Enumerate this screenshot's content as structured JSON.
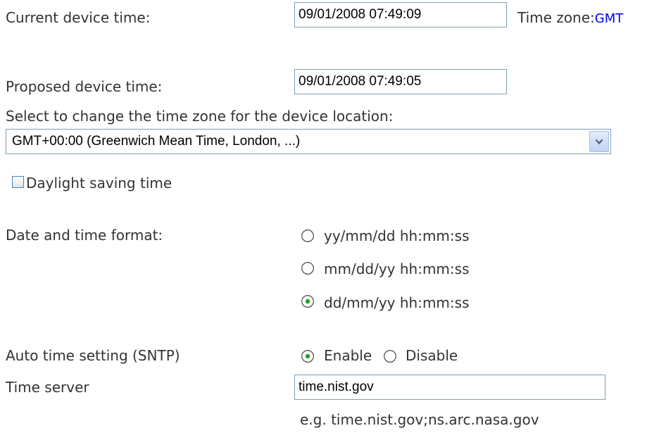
{
  "current_time": {
    "label": "Current device time:",
    "value": "09/01/2008 07:49:09",
    "tz_label": "Time zone:",
    "tz_value": "GMT"
  },
  "proposed_time": {
    "label": "Proposed device time:",
    "value": "09/01/2008 07:49:05"
  },
  "timezone": {
    "label": "Select to change the time zone for the device location:",
    "selected": "GMT+00:00 (Greenwich Mean Time, London, ...)"
  },
  "daylight": {
    "label": "Daylight saving time",
    "checked": false
  },
  "format": {
    "label": "Date and time format:",
    "options": [
      "yy/mm/dd hh:mm:ss",
      "mm/dd/yy hh:mm:ss",
      "dd/mm/yy hh:mm:ss"
    ],
    "selected_index": 2
  },
  "sntp": {
    "label": "Auto time setting (SNTP)",
    "enable_label": "Enable",
    "disable_label": "Disable",
    "selected": "Enable"
  },
  "server": {
    "label": "Time server",
    "value": "time.nist.gov",
    "hint": "e.g. time.nist.gov;ns.arc.nasa.gov"
  },
  "colors": {
    "text": "#333333",
    "tz_value": "#0000ee",
    "field_border": "#7f9db9",
    "radio_checked_dot": "#21a121"
  }
}
